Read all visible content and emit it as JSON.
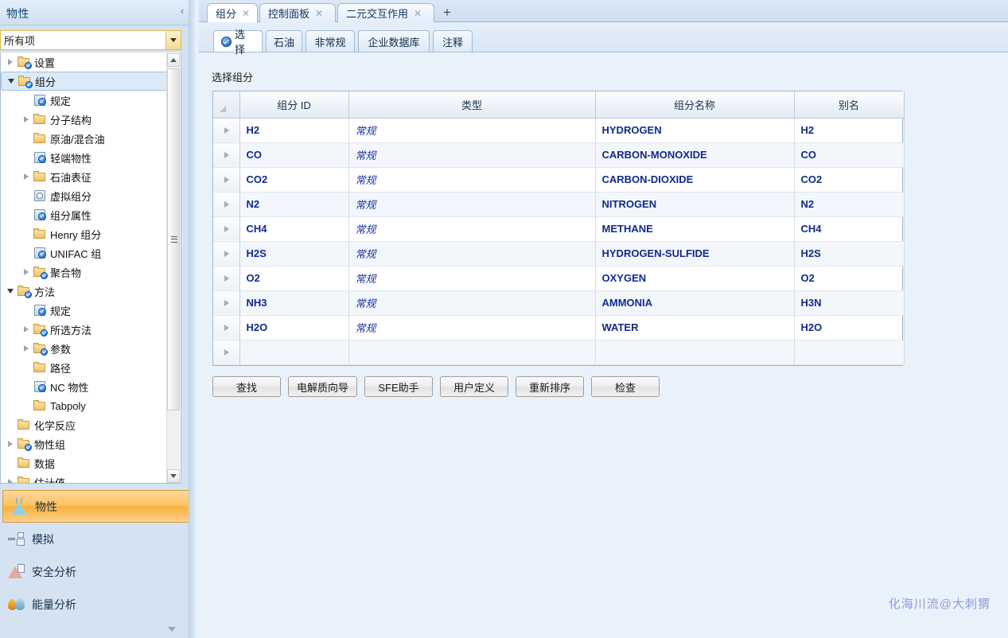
{
  "sidebar": {
    "title": "物性",
    "collapse_icon": "chevron-left-icon",
    "filter": {
      "value": "所有项",
      "placeholder": "所有项"
    },
    "tree": [
      {
        "label": "设置",
        "indent": 0,
        "twisty": "closed",
        "icon": "folder-check-icon",
        "selected": false
      },
      {
        "label": "组分",
        "indent": 0,
        "twisty": "open",
        "icon": "folder-check-icon",
        "selected": true
      },
      {
        "label": "规定",
        "indent": 1,
        "twisty": "none",
        "icon": "sheet-check-icon",
        "selected": false
      },
      {
        "label": "分子结构",
        "indent": 1,
        "twisty": "closed",
        "icon": "folder-icon",
        "selected": false
      },
      {
        "label": "原油/混合油",
        "indent": 1,
        "twisty": "none",
        "icon": "folder-icon",
        "selected": false
      },
      {
        "label": "轻端物性",
        "indent": 1,
        "twisty": "none",
        "icon": "sheet-check-icon",
        "selected": false
      },
      {
        "label": "石油表征",
        "indent": 1,
        "twisty": "closed",
        "icon": "folder-icon",
        "selected": false
      },
      {
        "label": "虚拟组分",
        "indent": 1,
        "twisty": "none",
        "icon": "circle-icon",
        "selected": false
      },
      {
        "label": "组分属性",
        "indent": 1,
        "twisty": "none",
        "icon": "sheet-check-icon",
        "selected": false
      },
      {
        "label": "Henry 组分",
        "indent": 1,
        "twisty": "none",
        "icon": "folder-icon",
        "selected": false
      },
      {
        "label": "UNIFAC 组",
        "indent": 1,
        "twisty": "none",
        "icon": "sheet-check-icon",
        "selected": false
      },
      {
        "label": "聚合物",
        "indent": 1,
        "twisty": "closed",
        "icon": "folder-check-icon",
        "selected": false
      },
      {
        "label": "方法",
        "indent": 0,
        "twisty": "open",
        "icon": "folder-check-icon",
        "selected": false
      },
      {
        "label": "规定",
        "indent": 1,
        "twisty": "none",
        "icon": "sheet-check-icon",
        "selected": false
      },
      {
        "label": "所选方法",
        "indent": 1,
        "twisty": "closed",
        "icon": "folder-check-icon",
        "selected": false
      },
      {
        "label": "参数",
        "indent": 1,
        "twisty": "closed",
        "icon": "folder-check-icon",
        "selected": false
      },
      {
        "label": "路径",
        "indent": 1,
        "twisty": "none",
        "icon": "folder-icon",
        "selected": false
      },
      {
        "label": "NC 物性",
        "indent": 1,
        "twisty": "none",
        "icon": "sheet-check-icon",
        "selected": false
      },
      {
        "label": "Tabpoly",
        "indent": 1,
        "twisty": "none",
        "icon": "folder-icon",
        "selected": false
      },
      {
        "label": "化学反应",
        "indent": 0,
        "twisty": "none",
        "icon": "folder-icon",
        "selected": false
      },
      {
        "label": "物性组",
        "indent": 0,
        "twisty": "closed",
        "icon": "folder-check-icon",
        "selected": false
      },
      {
        "label": "数据",
        "indent": 0,
        "twisty": "none",
        "icon": "folder-icon",
        "selected": false
      },
      {
        "label": "估计值",
        "indent": 0,
        "twisty": "closed",
        "icon": "folder-icon",
        "selected": false
      }
    ],
    "nav": [
      {
        "label": "物性",
        "icon": "flask-icon",
        "active": true
      },
      {
        "label": "模拟",
        "icon": "flowsheet-icon",
        "active": false
      },
      {
        "label": "安全分析",
        "icon": "safety-icon",
        "active": false
      },
      {
        "label": "能量分析",
        "icon": "energy-icon",
        "active": false
      }
    ],
    "nav_more_icon": "chevron-down-icon"
  },
  "doc_tabs": {
    "items": [
      {
        "label": "组分",
        "active": true,
        "close_icon": "close-icon"
      },
      {
        "label": "控制面板",
        "active": false,
        "close_icon": "close-icon"
      },
      {
        "label": "二元交互作用",
        "active": false,
        "close_icon": "close-icon"
      }
    ],
    "add_label": "+"
  },
  "sub_tabs": {
    "items": [
      {
        "label": "选择",
        "active": true,
        "icon": "check-circle-icon"
      },
      {
        "label": "石油",
        "active": false,
        "icon": ""
      },
      {
        "label": "非常规",
        "active": false,
        "icon": ""
      },
      {
        "label": "企业数据库",
        "active": false,
        "icon": ""
      },
      {
        "label": "注释",
        "active": false,
        "icon": ""
      }
    ]
  },
  "content": {
    "title": "选择组分",
    "grid": {
      "columns": [
        "组分 ID",
        "类型",
        "组分名称",
        "别名"
      ],
      "rows": [
        {
          "id": "H2",
          "type": "常规",
          "name": "HYDROGEN",
          "alias": "H2"
        },
        {
          "id": "CO",
          "type": "常规",
          "name": "CARBON-MONOXIDE",
          "alias": "CO"
        },
        {
          "id": "CO2",
          "type": "常规",
          "name": "CARBON-DIOXIDE",
          "alias": "CO2"
        },
        {
          "id": "N2",
          "type": "常规",
          "name": "NITROGEN",
          "alias": "N2"
        },
        {
          "id": "CH4",
          "type": "常规",
          "name": "METHANE",
          "alias": "CH4"
        },
        {
          "id": "H2S",
          "type": "常规",
          "name": "HYDROGEN-SULFIDE",
          "alias": "H2S"
        },
        {
          "id": "O2",
          "type": "常规",
          "name": "OXYGEN",
          "alias": "O2"
        },
        {
          "id": "NH3",
          "type": "常规",
          "name": "AMMONIA",
          "alias": "H3N"
        },
        {
          "id": "H2O",
          "type": "常规",
          "name": "WATER",
          "alias": "H2O"
        },
        {
          "id": "",
          "type": "",
          "name": "",
          "alias": ""
        }
      ]
    },
    "buttons": [
      {
        "label": "查找"
      },
      {
        "label": "电解质向导"
      },
      {
        "label": "SFE助手"
      },
      {
        "label": "用户定义"
      },
      {
        "label": "重新排序"
      },
      {
        "label": "检查"
      }
    ],
    "watermark": "化海川流@大刺猬"
  },
  "colors": {
    "sidebar_bg": "#d4e2f2",
    "accent_orange": "#f8b23f",
    "grid_text": "#112a8a",
    "watermark": "#8e9fd8",
    "filter_border": "#e0b949"
  }
}
